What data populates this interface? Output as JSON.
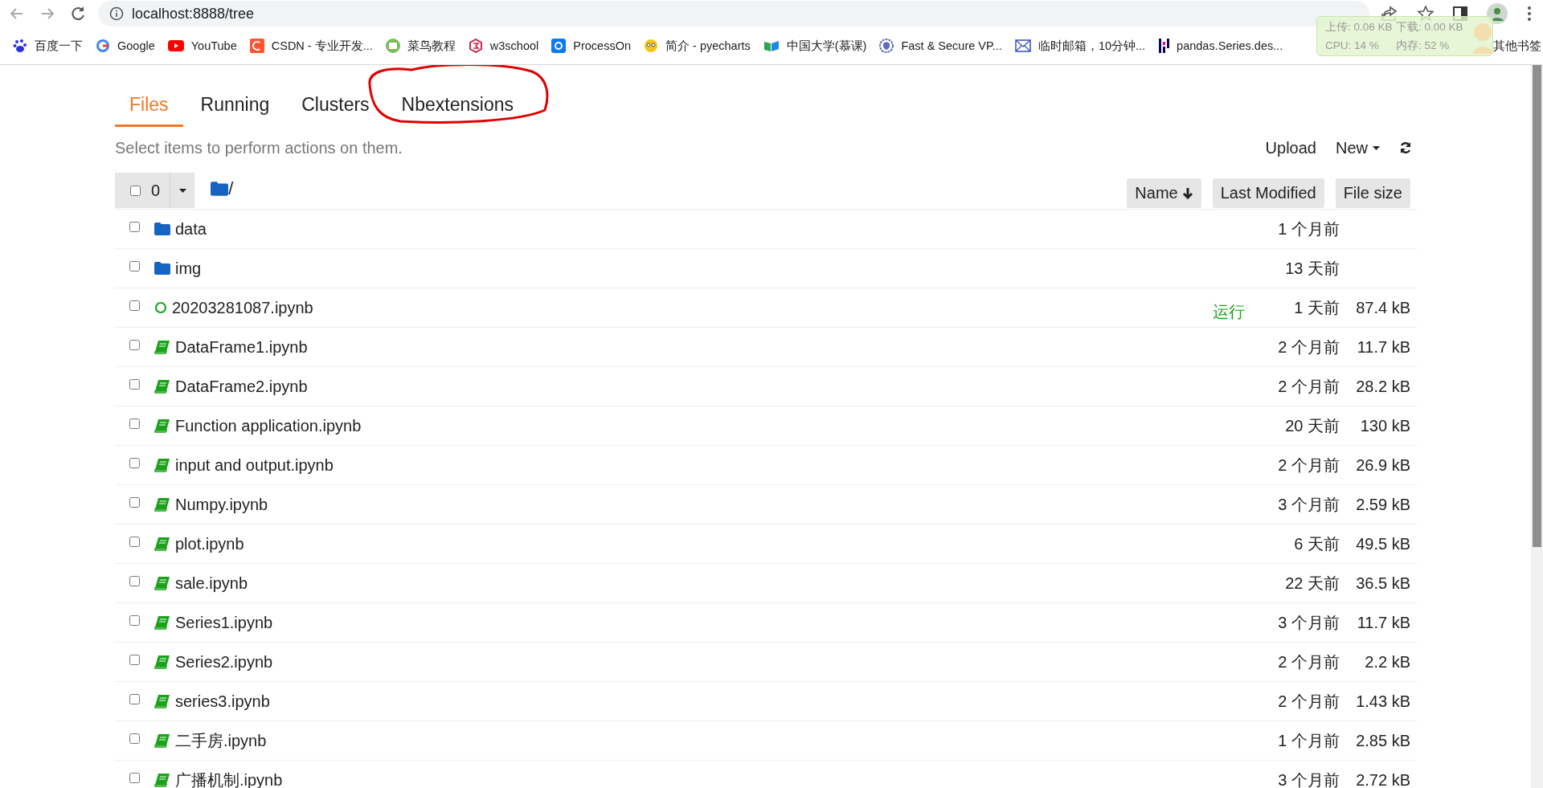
{
  "browser": {
    "url": "localhost:8888/tree",
    "bookmarks": [
      "百度一下",
      "Google",
      "YouTube",
      "CSDN - 专业开发...",
      "菜鸟教程",
      "w3school",
      "ProcessOn",
      "简介 - pyecharts",
      "中国大学(慕课)",
      "Fast & Secure VP...",
      "临时邮箱，10分钟...",
      "pandas.Series.des...",
      "其他书签"
    ]
  },
  "monitor": {
    "upload": "上传: 0.06 KB",
    "download": "下载: 0.00 KB",
    "cpu": "CPU: 14 %",
    "memory": "内存: 52 %"
  },
  "tabs": [
    {
      "label": "Files",
      "selected": true,
      "highlighted": false
    },
    {
      "label": "Running",
      "selected": false,
      "highlighted": false
    },
    {
      "label": "Clusters",
      "selected": false,
      "highlighted": false
    },
    {
      "label": "Nbextensions",
      "selected": false,
      "highlighted": true
    }
  ],
  "toolbar": {
    "hint": "Select items to perform actions on them.",
    "upload": "Upload",
    "new": "New",
    "selected_count": "0",
    "select_all": false,
    "path": "/"
  },
  "columns": [
    {
      "label": "Name",
      "sorted": true
    },
    {
      "label": "Last Modified",
      "sorted": false
    },
    {
      "label": "File size",
      "sorted": false
    }
  ],
  "files": [
    {
      "kind": "folder",
      "name": "data",
      "checked": false,
      "modified": "1 个月前"
    },
    {
      "kind": "folder",
      "name": "img",
      "checked": false,
      "modified": "13 天前"
    },
    {
      "kind": "running",
      "name": "20203281087.ipynb",
      "checked": false,
      "status": "运行",
      "modified": "1 天前",
      "size": "87.4 kB"
    },
    {
      "kind": "notebook",
      "name": "DataFrame1.ipynb",
      "checked": false,
      "modified": "2 个月前",
      "size": "11.7 kB"
    },
    {
      "kind": "notebook",
      "name": "DataFrame2.ipynb",
      "checked": false,
      "modified": "2 个月前",
      "size": "28.2 kB"
    },
    {
      "kind": "notebook",
      "name": "Function application.ipynb",
      "checked": false,
      "modified": "20 天前",
      "size": "130 kB"
    },
    {
      "kind": "notebook",
      "name": "input and output.ipynb",
      "checked": false,
      "modified": "2 个月前",
      "size": "26.9 kB"
    },
    {
      "kind": "notebook",
      "name": "Numpy.ipynb",
      "checked": false,
      "modified": "3 个月前",
      "size": "2.59 kB"
    },
    {
      "kind": "notebook",
      "name": "plot.ipynb",
      "checked": false,
      "modified": "6 天前",
      "size": "49.5 kB"
    },
    {
      "kind": "notebook",
      "name": "sale.ipynb",
      "checked": false,
      "modified": "22 天前",
      "size": "36.5 kB"
    },
    {
      "kind": "notebook",
      "name": "Series1.ipynb",
      "checked": false,
      "modified": "3 个月前",
      "size": "11.7 kB"
    },
    {
      "kind": "notebook",
      "name": "Series2.ipynb",
      "checked": false,
      "modified": "2 个月前",
      "size": "2.2 kB"
    },
    {
      "kind": "notebook",
      "name": "series3.ipynb",
      "checked": false,
      "modified": "2 个月前",
      "size": "1.43 kB"
    },
    {
      "kind": "notebook",
      "name": "二手房.ipynb",
      "checked": false,
      "modified": "1 个月前",
      "size": "2.85 kB"
    },
    {
      "kind": "notebook",
      "name": "广播机制.ipynb",
      "checked": false,
      "modified": "3 个月前",
      "size": "2.72 kB"
    }
  ]
}
